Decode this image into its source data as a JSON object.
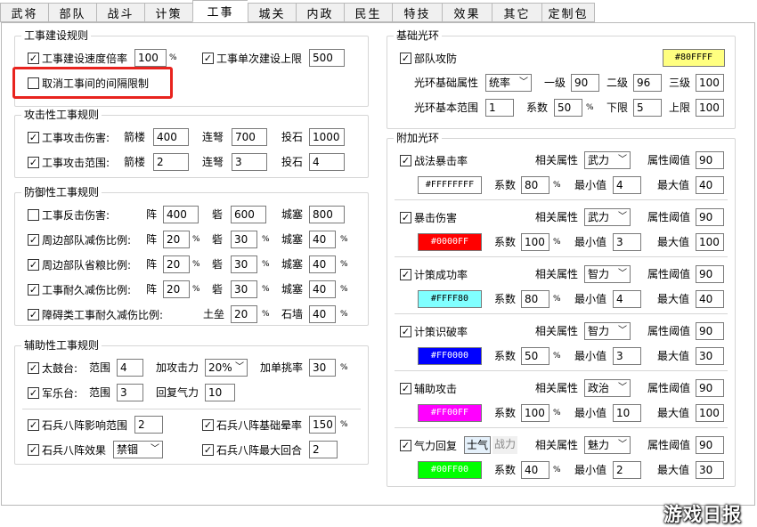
{
  "tabs": [
    "武将",
    "部队",
    "战斗",
    "计策",
    "工事",
    "城关",
    "内政",
    "民生",
    "特技",
    "效果",
    "其它",
    "定制包"
  ],
  "construction_rules": {
    "title": "工事建设规则",
    "speed_label": "工事建设速度倍率",
    "speed_value": "100",
    "speed_unit": "%",
    "single_limit_label": "工事单次建设上限",
    "single_limit_value": "500",
    "cancel_interval_label": "取消工事间的间隔限制"
  },
  "attack_rules": {
    "title": "攻击性工事规则",
    "damage_label": "工事攻击伤害:",
    "range_label": "工事攻击范围:",
    "arrow_tower": "箭楼",
    "crossbow": "连弩",
    "catapult": "投石",
    "damage": [
      "400",
      "700",
      "1000"
    ],
    "range": [
      "2",
      "3",
      "4"
    ]
  },
  "defense_rules": {
    "title": "防御性工事规则",
    "row1_label": "工事反击伤害:",
    "row1": [
      "400",
      "600",
      "800"
    ],
    "row2_label": "周边部队减伤比例:",
    "row2": [
      "20",
      "30",
      "40"
    ],
    "row3_label": "周边部队省粮比例:",
    "row3": [
      "20",
      "30",
      "40"
    ],
    "row4_label": "工事耐久减伤比例:",
    "row4": [
      "20",
      "30",
      "40"
    ],
    "row5_label": "障碍类工事耐久减伤比例:",
    "row5": [
      "20",
      "40"
    ],
    "zhen": "阵",
    "zhai": "砦",
    "chengsai": "城塞",
    "tulei": "土垒",
    "shiqiang": "石墙",
    "unit": "%"
  },
  "aux_rules": {
    "title": "辅助性工事规则",
    "drum_label": "太鼓台:",
    "music_label": "军乐台:",
    "range": "范围",
    "drum_range": "4",
    "music_range": "3",
    "attack_boost_label": "加攻击力",
    "attack_boost_value": "20%",
    "challenge_label": "加单挑率",
    "challenge_value": "30",
    "unit": "%",
    "morale_label": "回复气力",
    "morale_value": "10",
    "stone_range_label": "石兵八阵影响范围",
    "stone_range_value": "2",
    "stone_stun_label": "石兵八阵基础晕率",
    "stone_stun_value": "150",
    "stone_effect_label": "石兵八阵效果",
    "stone_effect_value": "禁锢",
    "stone_rounds_label": "石兵八阵最大回合",
    "stone_rounds_value": "2"
  },
  "base_halo": {
    "title": "基础光环",
    "attack_label": "部队攻防",
    "attack_color": "#80FFFF",
    "attr_label": "光环基础属性",
    "attr_value": "统率",
    "level1_label": "一级",
    "level1": "90",
    "level2_label": "二级",
    "level2": "96",
    "level3_label": "三级",
    "level3": "100",
    "range_label": "光环基本范围",
    "range_value": "1",
    "coef_label": "系数",
    "coef_value": "50",
    "unit": "%",
    "low_label": "下限",
    "low_value": "5",
    "high_label": "上限",
    "high_value": "100"
  },
  "extra_halo": {
    "title": "附加光环",
    "related_attr": "相关属性",
    "threshold": "属性阈值",
    "coef": "系数",
    "min": "最小值",
    "max": "最大值",
    "unit": "%",
    "items": [
      {
        "name": "战法暴击率",
        "attr": "武力",
        "thr": "90",
        "color": "#FFFFFFFF",
        "bg": "#ffffff",
        "fg": "#000000",
        "coef": "80",
        "min": "4",
        "max": "40"
      },
      {
        "name": "暴击伤害",
        "attr": "武力",
        "thr": "90",
        "color": "#0000FF",
        "bg": "#ff0000",
        "fg": "#ffffff",
        "coef": "100",
        "min": "3",
        "max": "100"
      },
      {
        "name": "计策成功率",
        "attr": "智力",
        "thr": "90",
        "color": "#FFFF80",
        "bg": "#80ffff",
        "fg": "#000000",
        "coef": "80",
        "min": "4",
        "max": "40"
      },
      {
        "name": "计策识破率",
        "attr": "智力",
        "thr": "90",
        "color": "#FF0000",
        "bg": "#0000ff",
        "fg": "#ffffff",
        "coef": "50",
        "min": "3",
        "max": "30"
      },
      {
        "name": "辅助攻击",
        "attr": "政治",
        "thr": "90",
        "color": "#FF00FF",
        "bg": "#ff00ff",
        "fg": "#ffffff",
        "coef": "100",
        "min": "10",
        "max": "100"
      },
      {
        "name": "气力回复",
        "attr": "魅力",
        "thr": "90",
        "color": "#00FF00",
        "bg": "#00ff00",
        "fg": "#ffffff",
        "coef": "40",
        "min": "2",
        "max": "30"
      }
    ],
    "toggle_a": "士气",
    "toggle_b": "战力"
  },
  "watermark": "游戏日报"
}
